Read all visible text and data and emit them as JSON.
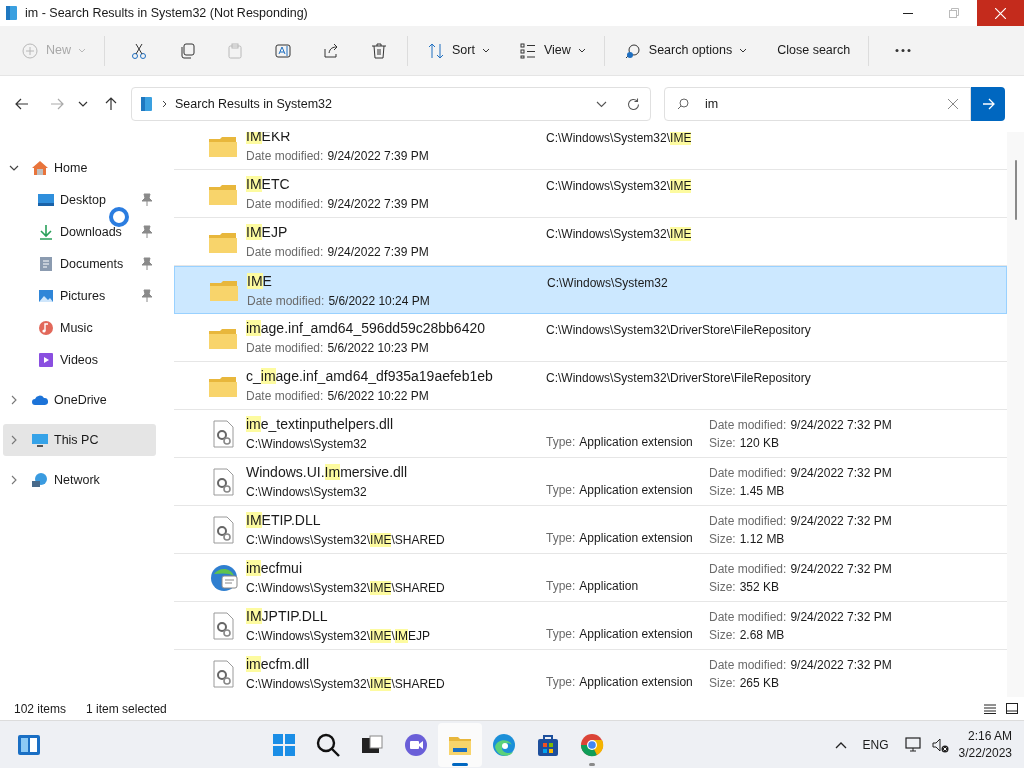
{
  "window": {
    "title": "im - Search Results in System32 (Not Responding)"
  },
  "toolbar": [
    {
      "kind": "new",
      "label": "New",
      "disabled": true
    },
    {
      "kind": "cut",
      "disabled": false
    },
    {
      "kind": "copy",
      "disabled": false
    },
    {
      "kind": "paste",
      "disabled": true
    },
    {
      "kind": "rename",
      "disabled": false
    },
    {
      "kind": "share",
      "disabled": false
    },
    {
      "kind": "delete",
      "disabled": false
    },
    {
      "kind": "sort",
      "label": "Sort",
      "disabled": false
    },
    {
      "kind": "view",
      "label": "View",
      "disabled": false
    },
    {
      "kind": "search_options",
      "label": "Search options",
      "disabled": false
    },
    {
      "kind": "close_search",
      "label": "Close search",
      "disabled": false
    },
    {
      "kind": "more",
      "disabled": false
    }
  ],
  "address": {
    "location": "Search Results in System32"
  },
  "search": {
    "value": "im"
  },
  "sidebar": {
    "items": [
      {
        "kind": "home",
        "label": "Home",
        "expanded": true,
        "selected": false,
        "children": [
          {
            "kind": "desktop",
            "label": "Desktop",
            "pinned": true
          },
          {
            "kind": "downloads",
            "label": "Downloads",
            "pinned": true
          },
          {
            "kind": "documents",
            "label": "Documents",
            "pinned": true
          },
          {
            "kind": "pictures",
            "label": "Pictures",
            "pinned": true
          },
          {
            "kind": "music",
            "label": "Music",
            "pinned": false
          },
          {
            "kind": "videos",
            "label": "Videos",
            "pinned": false
          }
        ]
      },
      {
        "kind": "onedrive",
        "label": "OneDrive",
        "expanded": false,
        "selected": false
      },
      {
        "kind": "pc",
        "label": "This PC",
        "expanded": false,
        "selected": true
      },
      {
        "kind": "network",
        "label": "Network",
        "expanded": false,
        "selected": false
      }
    ]
  },
  "results": [
    {
      "kind": "folder",
      "selected": false,
      "name": [
        {
          "text": "IM",
          "match": true
        },
        {
          "text": "EKR",
          "match": false
        }
      ],
      "date_label": "Date modified:",
      "date": "9/24/2022 7:39 PM",
      "path": [
        {
          "text": "C:\\Windows\\System32\\",
          "match": false
        },
        {
          "text": "IME",
          "match": true
        }
      ]
    },
    {
      "kind": "folder",
      "selected": false,
      "name": [
        {
          "text": "IM",
          "match": true
        },
        {
          "text": "ETC",
          "match": false
        }
      ],
      "date_label": "Date modified:",
      "date": "9/24/2022 7:39 PM",
      "path": [
        {
          "text": "C:\\Windows\\System32\\",
          "match": false
        },
        {
          "text": "IME",
          "match": true
        }
      ]
    },
    {
      "kind": "folder",
      "selected": false,
      "name": [
        {
          "text": "IM",
          "match": true
        },
        {
          "text": "EJP",
          "match": false
        }
      ],
      "date_label": "Date modified:",
      "date": "9/24/2022 7:39 PM",
      "path": [
        {
          "text": "C:\\Windows\\System32\\",
          "match": false
        },
        {
          "text": "IME",
          "match": true
        }
      ]
    },
    {
      "kind": "folder",
      "selected": true,
      "name": [
        {
          "text": "IM",
          "match": true
        },
        {
          "text": "E",
          "match": false
        }
      ],
      "date_label": "Date modified:",
      "date": "5/6/2022 10:24 PM",
      "path": [
        {
          "text": "C:\\Windows\\System32",
          "match": false
        }
      ]
    },
    {
      "kind": "folder",
      "selected": false,
      "name": [
        {
          "text": "im",
          "match": true
        },
        {
          "text": "age.inf_amd64_596dd59c28bb6420",
          "match": false
        }
      ],
      "date_label": "Date modified:",
      "date": "5/6/2022 10:23 PM",
      "path": [
        {
          "text": "C:\\Windows\\System32\\DriverStore\\FileRepository",
          "match": false
        }
      ]
    },
    {
      "kind": "folder",
      "selected": false,
      "name": [
        {
          "text": "c_",
          "match": false
        },
        {
          "text": "im",
          "match": true
        },
        {
          "text": "age.inf_amd64_df935a19aefeb1eb",
          "match": false
        }
      ],
      "date_label": "Date modified:",
      "date": "5/6/2022 10:22 PM",
      "path": [
        {
          "text": "C:\\Windows\\System32\\DriverStore\\FileRepository",
          "match": false
        }
      ]
    },
    {
      "kind": "dll",
      "selected": false,
      "name": [
        {
          "text": "im",
          "match": true
        },
        {
          "text": "e_textinputhelpers.dll",
          "match": false
        }
      ],
      "path": [
        {
          "text": "C:\\Windows\\System32",
          "match": false
        }
      ],
      "type_label": "Type:",
      "type": "Application extension",
      "date_label": "Date modified:",
      "date": "9/24/2022 7:32 PM",
      "size_label": "Size:",
      "size": "120 KB"
    },
    {
      "kind": "dll",
      "selected": false,
      "name": [
        {
          "text": "Windows.UI.",
          "match": false
        },
        {
          "text": "Im",
          "match": true
        },
        {
          "text": "mersive.dll",
          "match": false
        }
      ],
      "path": [
        {
          "text": "C:\\Windows\\System32",
          "match": false
        }
      ],
      "type_label": "Type:",
      "type": "Application extension",
      "date_label": "Date modified:",
      "date": "9/24/2022 7:32 PM",
      "size_label": "Size:",
      "size": "1.45 MB"
    },
    {
      "kind": "dll",
      "selected": false,
      "name": [
        {
          "text": "IM",
          "match": true
        },
        {
          "text": "ETIP.DLL",
          "match": false
        }
      ],
      "path": [
        {
          "text": "C:\\Windows\\System32\\",
          "match": false
        },
        {
          "text": "IME",
          "match": true
        },
        {
          "text": "\\SHARED",
          "match": false
        }
      ],
      "type_label": "Type:",
      "type": "Application extension",
      "date_label": "Date modified:",
      "date": "9/24/2022 7:32 PM",
      "size_label": "Size:",
      "size": "1.12 MB"
    },
    {
      "kind": "app",
      "selected": false,
      "name": [
        {
          "text": "im",
          "match": true
        },
        {
          "text": "ecfmui",
          "match": false
        }
      ],
      "path": [
        {
          "text": "C:\\Windows\\System32\\",
          "match": false
        },
        {
          "text": "IME",
          "match": true
        },
        {
          "text": "\\SHARED",
          "match": false
        }
      ],
      "type_label": "Type:",
      "type": "Application",
      "date_label": "Date modified:",
      "date": "9/24/2022 7:32 PM",
      "size_label": "Size:",
      "size": "352 KB"
    },
    {
      "kind": "dll",
      "selected": false,
      "name": [
        {
          "text": "IM",
          "match": true
        },
        {
          "text": "JPTIP.DLL",
          "match": false
        }
      ],
      "path": [
        {
          "text": "C:\\Windows\\System32\\",
          "match": false
        },
        {
          "text": "IME",
          "match": true
        },
        {
          "text": "\\",
          "match": false
        },
        {
          "text": "IM",
          "match": true
        },
        {
          "text": "EJP",
          "match": false
        }
      ],
      "type_label": "Type:",
      "type": "Application extension",
      "date_label": "Date modified:",
      "date": "9/24/2022 7:32 PM",
      "size_label": "Size:",
      "size": "2.68 MB"
    },
    {
      "kind": "dll",
      "selected": false,
      "name": [
        {
          "text": "im",
          "match": true
        },
        {
          "text": "ecfm.dll",
          "match": false
        }
      ],
      "path": [
        {
          "text": "C:\\Windows\\System32\\",
          "match": false
        },
        {
          "text": "IME",
          "match": true
        },
        {
          "text": "\\SHARED",
          "match": false
        }
      ],
      "type_label": "Type:",
      "type": "Application extension",
      "date_label": "Date modified:",
      "date": "9/24/2022 7:32 PM",
      "size_label": "Size:",
      "size": "265 KB"
    }
  ],
  "status_bar": {
    "count": "102 items",
    "selection": "1 item selected"
  },
  "taskbar": {
    "apps": [
      {
        "kind": "start",
        "active": false,
        "running": false
      },
      {
        "kind": "search",
        "active": false,
        "running": false
      },
      {
        "kind": "taskview",
        "active": false,
        "running": false
      },
      {
        "kind": "chat",
        "active": false,
        "running": false
      },
      {
        "kind": "explorer",
        "active": true,
        "running": true
      },
      {
        "kind": "edge",
        "active": false,
        "running": false
      },
      {
        "kind": "store",
        "active": false,
        "running": false
      },
      {
        "kind": "chrome",
        "active": false,
        "running": true
      }
    ],
    "language": "ENG",
    "time": "2:16 AM",
    "date": "3/22/2023"
  }
}
